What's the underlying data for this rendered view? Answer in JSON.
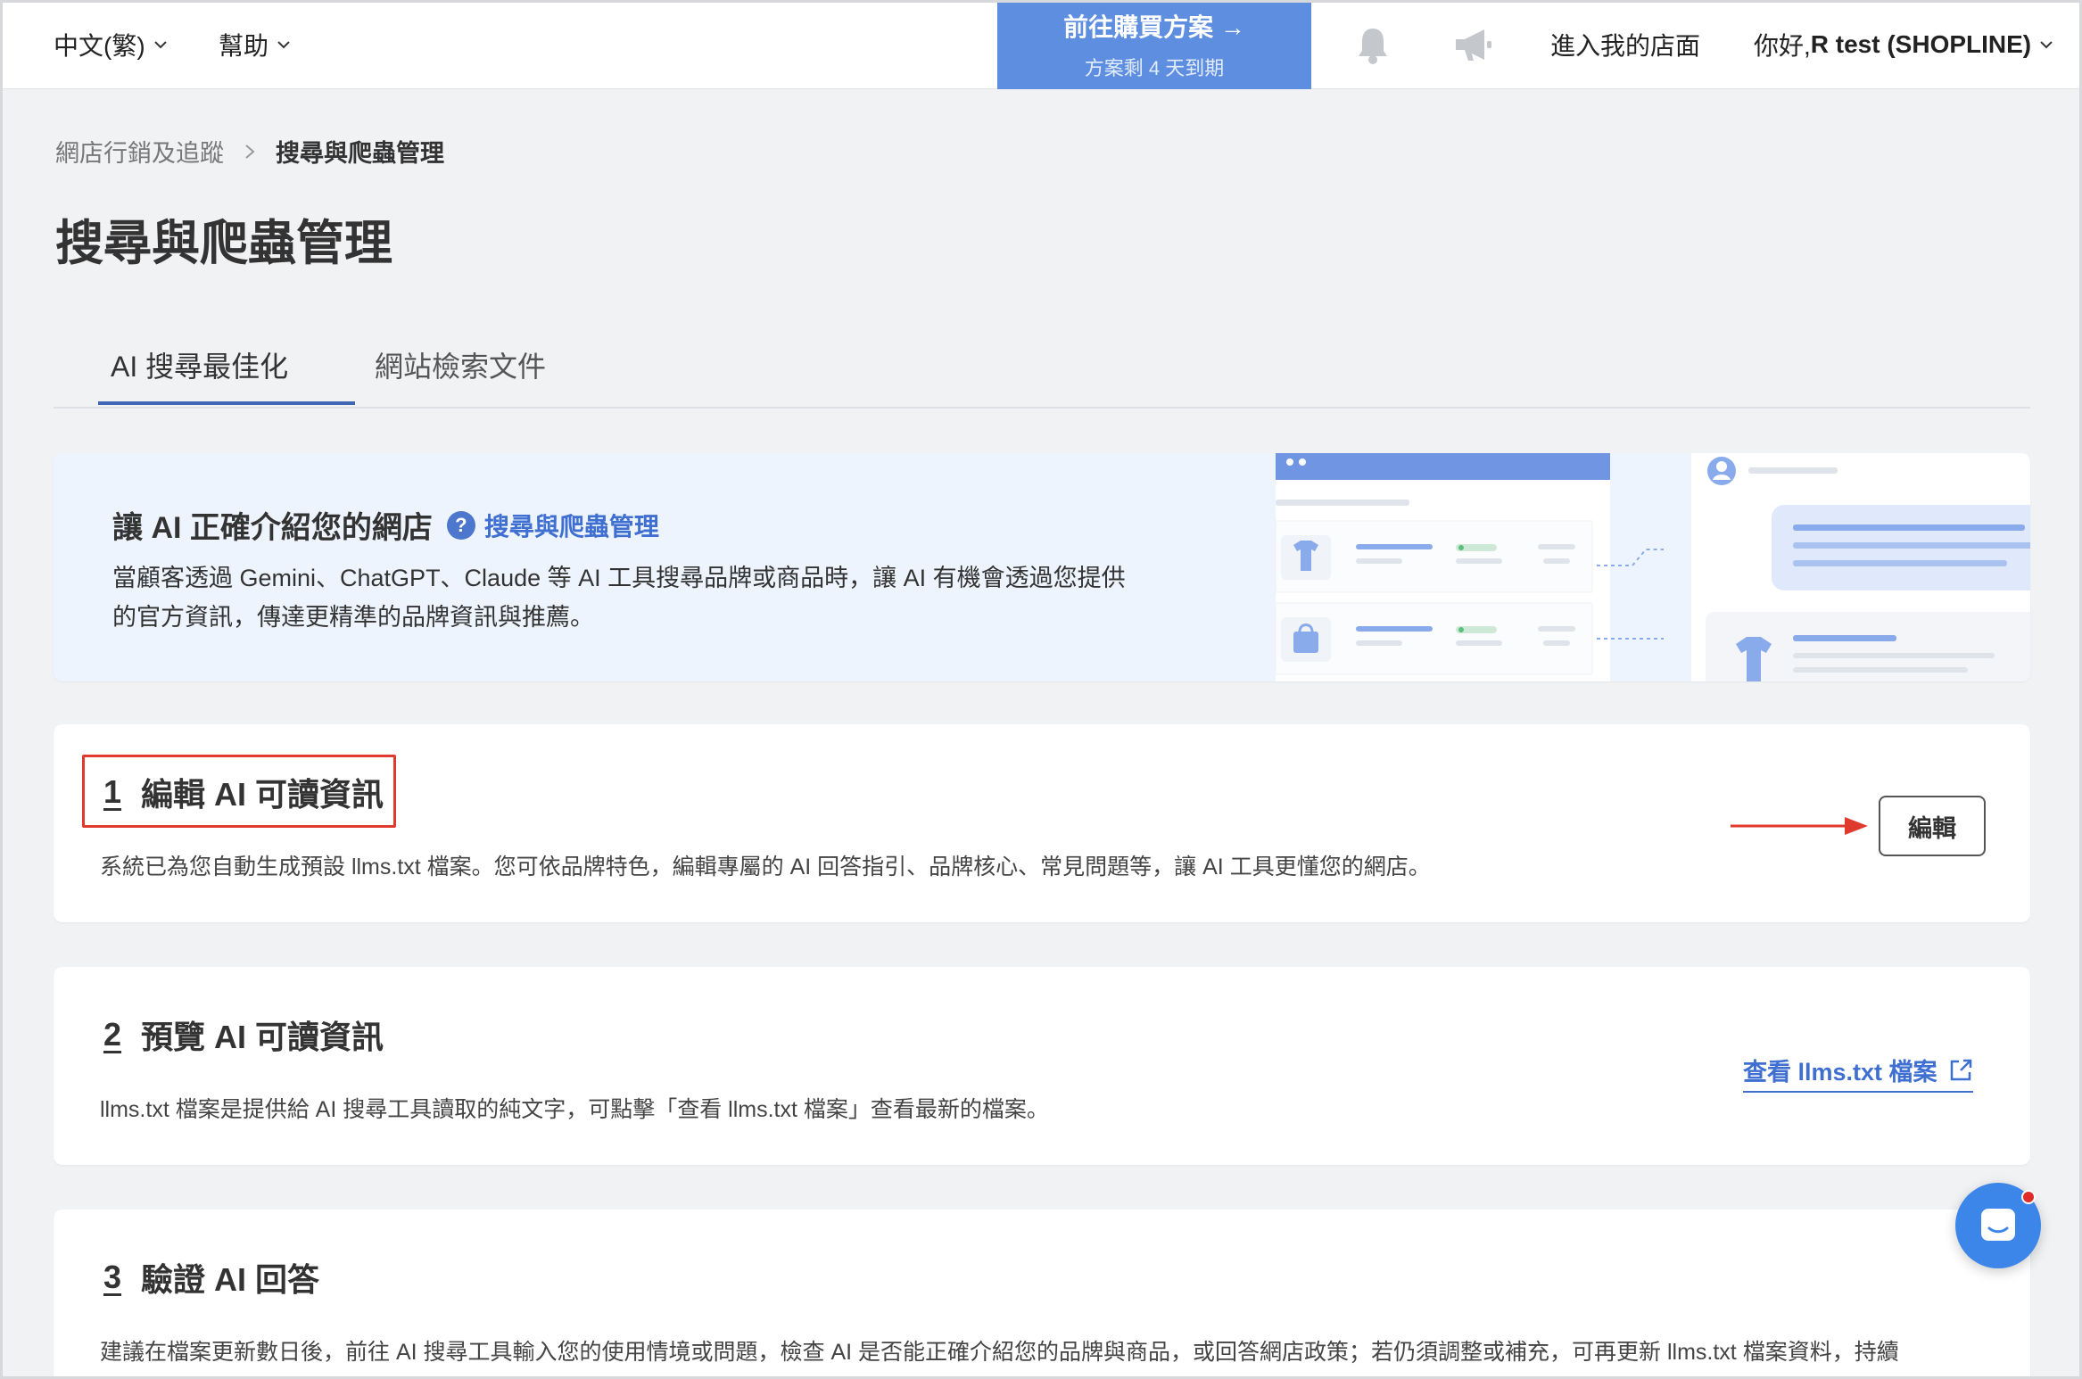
{
  "nav": {
    "language": "中文(繁)",
    "help": "幫助",
    "plan_main": "前往購買方案 →",
    "plan_sub": "方案剩 4 天到期",
    "store": "進入我的店面",
    "greeting_prefix": "你好, ",
    "user": "R test (SHOPLINE)"
  },
  "breadcrumb": {
    "parent": "網店行銷及追蹤",
    "current": "搜尋與爬蟲管理"
  },
  "page_title": "搜尋與爬蟲管理",
  "tabs": [
    {
      "label": "AI 搜尋最佳化",
      "active": true
    },
    {
      "label": "網站檢索文件",
      "active": false
    }
  ],
  "banner": {
    "title": "讓 AI 正確介紹您的網店",
    "help_icon": "question-icon",
    "help_link": "搜尋與爬蟲管理",
    "desc_line1": "當顧客透過 Gemini、ChatGPT、Claude 等 AI 工具搜尋品牌或商品時，讓 AI 有機會透過您提供",
    "desc_line2": "的官方資訊，傳達更精準的品牌資訊與推薦。"
  },
  "steps": [
    {
      "num": "1",
      "title": "編輯 AI 可讀資訊",
      "desc": "系統已為您自動生成預設 llms.txt 檔案。您可依品牌特色，編輯專屬的 AI 回答指引、品牌核心、常見問題等，讓 AI 工具更懂您的網店。",
      "action": "編輯"
    },
    {
      "num": "2",
      "title": "預覽 AI 可讀資訊",
      "desc": "llms.txt 檔案是提供給 AI 搜尋工具讀取的純文字，可點擊「查看 llms.txt 檔案」查看最新的檔案。",
      "action": "查看 llms.txt 檔案"
    },
    {
      "num": "3",
      "title": "驗證 AI 回答",
      "desc": "建議在檔案更新數日後，前往 AI 搜尋工具輸入您的使用情境或問題，檢查 AI 是否能正確介紹您的品牌與商品，或回答網店政策；若仍須調整或補充，可再更新 llms.txt 檔案資料，持續"
    }
  ],
  "colors": {
    "primary": "#5e8ee0",
    "link": "#3f6fd1",
    "highlight": "#e03a2e",
    "tab_active": "#3f65b4"
  }
}
